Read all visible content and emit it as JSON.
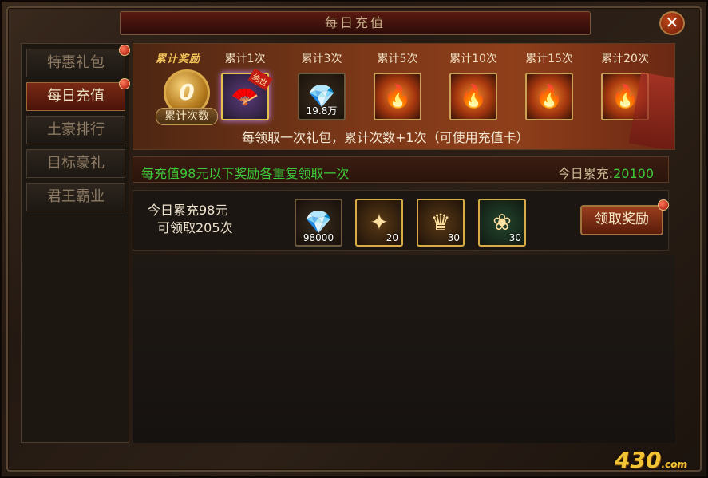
{
  "window": {
    "title": "每日充值",
    "close_icon": "✕"
  },
  "sidebar": {
    "items": [
      {
        "label": "特惠礼包",
        "active": false,
        "dot": true
      },
      {
        "label": "每日充值",
        "active": true,
        "dot": true
      },
      {
        "label": "土豪排行",
        "active": false,
        "dot": false
      },
      {
        "label": "目标豪礼",
        "active": false,
        "dot": false
      },
      {
        "label": "君王霸业",
        "active": false,
        "dot": false
      }
    ]
  },
  "banner": {
    "title": "累计奖励",
    "medal_number": "0",
    "medal_label": "累计次数",
    "tiers": [
      {
        "label": "累计1次",
        "icon": "fan-icon",
        "glyph": "🪭",
        "ribbon": "绝世"
      },
      {
        "label": "累计3次",
        "icon": "diamond-icon",
        "glyph": "💎",
        "count": "19.8万"
      },
      {
        "label": "累计5次",
        "icon": "fire-weapon-icon",
        "glyph": "🔥"
      },
      {
        "label": "累计10次",
        "icon": "fire-weapon-icon",
        "glyph": "🔥"
      },
      {
        "label": "累计15次",
        "icon": "fire-weapon-icon",
        "glyph": "🔥"
      },
      {
        "label": "累计20次",
        "icon": "fire-weapon-icon",
        "glyph": "🔥"
      }
    ],
    "note": "每领取一次礼包，累计次数+1次（可使用充值卡）"
  },
  "info": {
    "left": "每充值98元以下奖励各重复领取一次",
    "right_label": "今日累充:",
    "right_value": "20100"
  },
  "reward_row": {
    "line1": "今日累充98元",
    "line2": "可领取205次",
    "items": [
      {
        "icon": "diamond-icon",
        "glyph": "💎",
        "count": "98000"
      },
      {
        "icon": "gem-icon",
        "glyph": "✦",
        "count": "20"
      },
      {
        "icon": "helmet-icon",
        "glyph": "♛",
        "count": "30"
      },
      {
        "icon": "jade-icon",
        "glyph": "❀",
        "count": "30"
      }
    ],
    "claim_label": "领取奖励"
  },
  "watermark": {
    "main": "430",
    "sub": ".com"
  }
}
